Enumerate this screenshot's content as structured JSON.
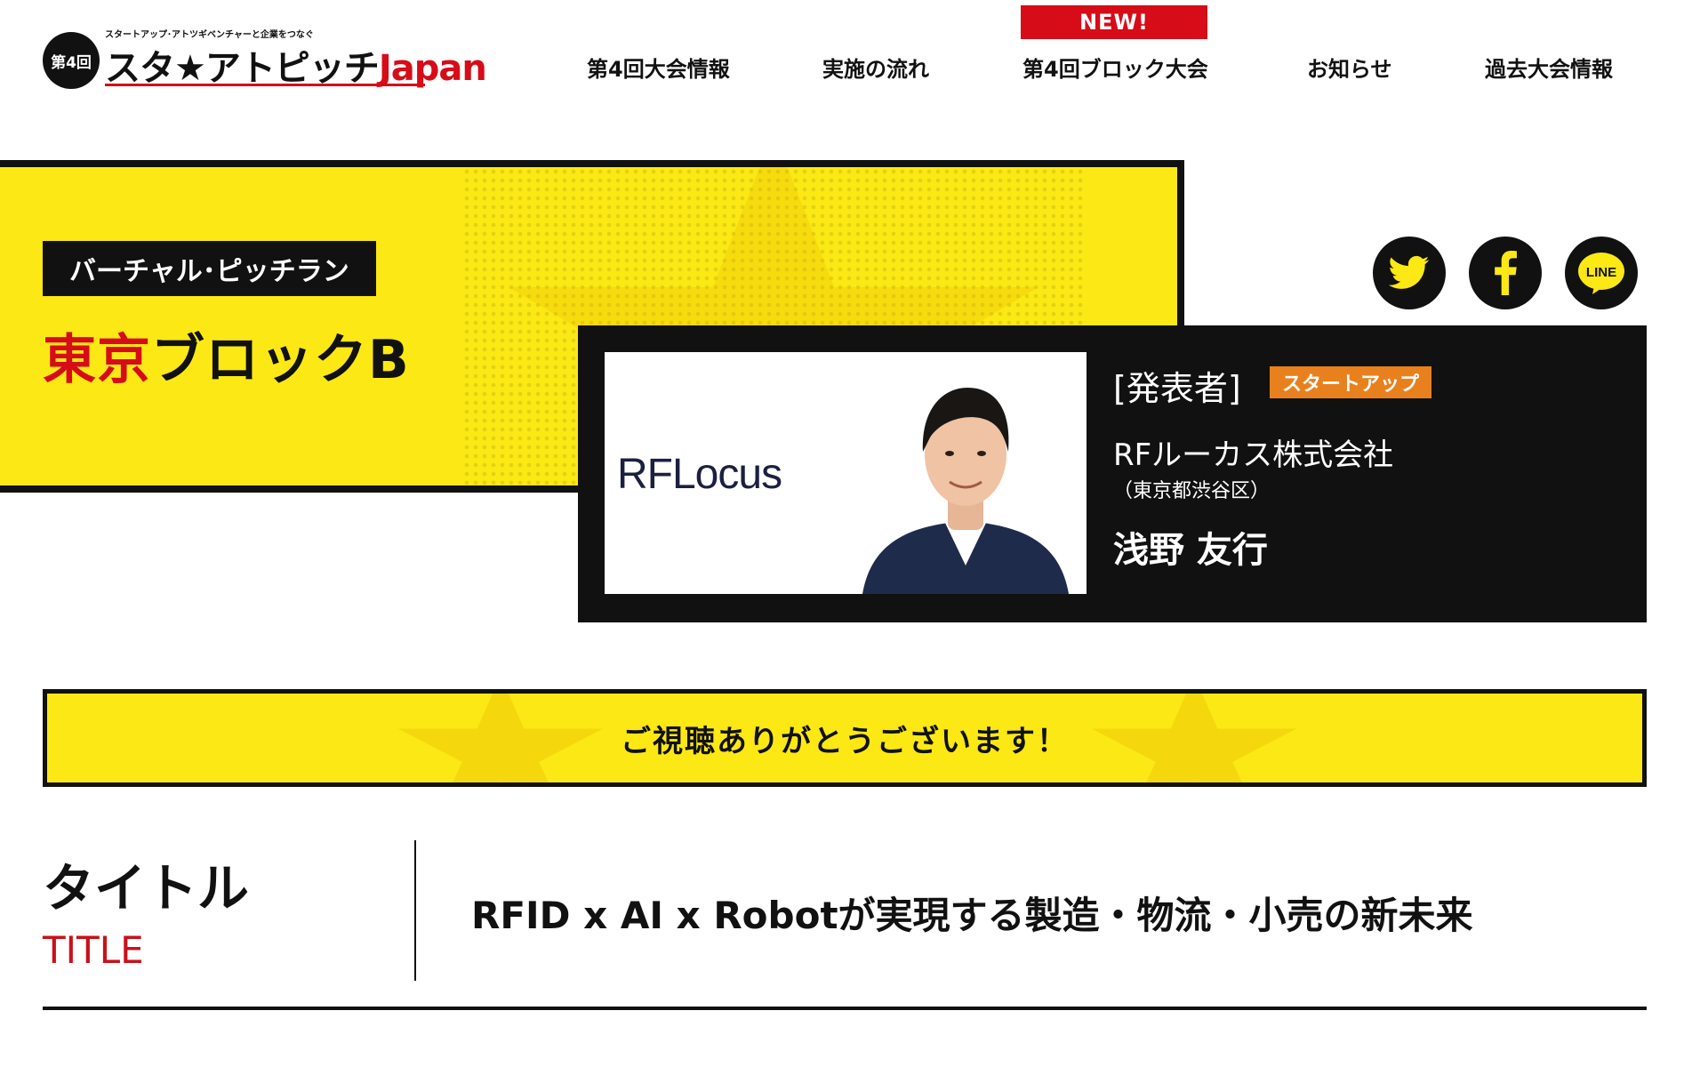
{
  "header": {
    "logo": {
      "badge": "第4回",
      "tagline": "スタートアップ･アトツギベンチャーと企業をつなぐ",
      "name": "スタ★アトピッチ",
      "name_suffix": "Japan"
    },
    "nav": [
      {
        "label": "第4回大会情報"
      },
      {
        "label": "実施の流れ"
      },
      {
        "label": "第4回ブロック大会",
        "badge": "NEW!"
      },
      {
        "label": "お知らせ"
      },
      {
        "label": "過去大会情報"
      }
    ]
  },
  "hero": {
    "event_label": "バーチャル･ピッチラン",
    "block_title_red": "東京",
    "block_title_rest": "ブロックB"
  },
  "share": [
    {
      "icon": "twitter-icon"
    },
    {
      "icon": "facebook-icon"
    },
    {
      "icon": "line-icon",
      "text": "LINE"
    }
  ],
  "presenter": {
    "company_logo": "RFLocus",
    "role": "[発表者]",
    "type": "スタートアップ",
    "company": "RFルーカス株式会社",
    "location": "（東京都渋谷区）",
    "name": "浅野 友行"
  },
  "thanks": "ご視聴ありがとうございます！",
  "title_section": {
    "label_jp": "タイトル",
    "label_en": "TITLE",
    "value": "RFID x AI  x  Robotが実現する製造・物流・小売の新未来"
  },
  "colors": {
    "brand_yellow": "#fbe814",
    "brand_red": "#d60c18",
    "badge_orange": "#e8811d",
    "ink": "#111111"
  }
}
